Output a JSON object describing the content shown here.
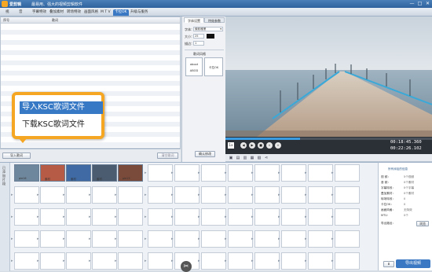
{
  "window": {
    "app_name": "爱剪辑",
    "title": "最易用、强大的视频剪辑软件",
    "controls": [
      "—",
      "□",
      "✕"
    ]
  },
  "menu_tabs": [
    "视",
    "音",
    "字幕特效",
    "叠加素材",
    "转场特效",
    "画面风格",
    "M T V",
    "卡拉OK",
    "升级与服务"
  ],
  "active_tab_index": 7,
  "list": {
    "headers": [
      "序号",
      "歌词"
    ],
    "row_count": 24
  },
  "settings": {
    "tabs": [
      "字体设置",
      "特效参数"
    ],
    "font_label": "字体：",
    "font_value": "微软雅黑",
    "size_label": "大小：",
    "size_value": "25",
    "color_value": "#111111",
    "spacing_label": "描边：",
    "spacing_value": "1",
    "effect_section": "歌词风格",
    "style_samples": [
      "aboot ABOD",
      "卡拉OK"
    ],
    "apply_button": "确认修改"
  },
  "list_buttons": {
    "import_button": "导入歌词",
    "clear_button": "清空歌词"
  },
  "popup": {
    "options": [
      "导入KSC歌词文件",
      "下载KSC歌词文件"
    ]
  },
  "player": {
    "current_time": "00:18:45.360",
    "total_time": "00:22:26.102",
    "speed_label": "1x"
  },
  "timeline": {
    "side_label": "已添加片段",
    "clips": [
      "pie16",
      "素材",
      "素材",
      "素材",
      "pie13"
    ],
    "placeholder": "双击此处添加视频"
  },
  "props": {
    "title": "所有添加的信息",
    "rows": [
      {
        "k": "视    频：",
        "v": "5个视频"
      },
      {
        "k": "音    频：",
        "v": "0个素材"
      },
      {
        "k": "字幕特效：",
        "v": "0个字幕"
      },
      {
        "k": "叠加素材：",
        "v": "0个素材"
      },
      {
        "k": "转场特效：",
        "v": "0"
      },
      {
        "k": "卡拉OK：",
        "v": "0"
      },
      {
        "k": "画面风格：",
        "v": "无特效"
      },
      {
        "k": "MTV：",
        "v": "0个"
      }
    ],
    "export_button": "导出视频",
    "export_path_label": "导出路径：",
    "browse_button": "浏览"
  },
  "colors": {
    "accent": "#3a78c3",
    "callout_border": "#f5a623",
    "titlebar": "#2f639e"
  }
}
